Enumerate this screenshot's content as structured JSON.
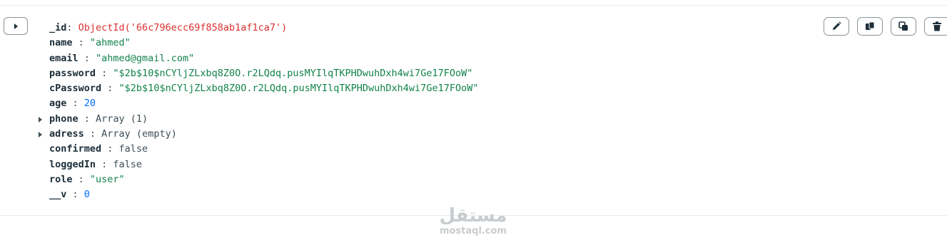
{
  "document": {
    "id_key": "_id",
    "id_value": "ObjectId('66c796ecc69f858ab1af1ca7')",
    "fields": [
      {
        "key": "name",
        "value": "\"ahmed\""
      },
      {
        "key": "email",
        "value": "\"ahmed@gmail.com\""
      },
      {
        "key": "password",
        "value": "\"$2b$10$nCYljZLxbq8Z0O.r2LQdq.pusMYIlqTKPHDwuhDxh4wi7Ge17FOoW\""
      },
      {
        "key": "cPassword",
        "value": "\"$2b$10$nCYljZLxbq8Z0O.r2LQdq.pusMYIlqTKPHDwuhDxh4wi7Ge17FOoW\""
      },
      {
        "key": "age",
        "value": "20"
      },
      {
        "key": "phone",
        "value": "Array (1)"
      },
      {
        "key": "adress",
        "value": "Array (empty)"
      },
      {
        "key": "confirmed",
        "value": "false"
      },
      {
        "key": "loggedIn",
        "value": "false"
      },
      {
        "key": "role",
        "value": "\"user\""
      },
      {
        "key": "__v",
        "value": "0"
      }
    ]
  },
  "actions": [
    "edit-document",
    "copy-document",
    "clone-document",
    "delete-document"
  ],
  "icons": {
    "expand": "caret-right-icon",
    "edit": "pencil-icon",
    "copy": "copy-icon",
    "clone": "clone-icon",
    "delete": "trash-icon"
  },
  "watermark": {
    "arabic": "مستقل",
    "latin": "mostaql.com"
  },
  "colors": {
    "string": "#12824d",
    "number": "#016bf8",
    "objectid": "#db3030",
    "key": "#1c2d38"
  }
}
